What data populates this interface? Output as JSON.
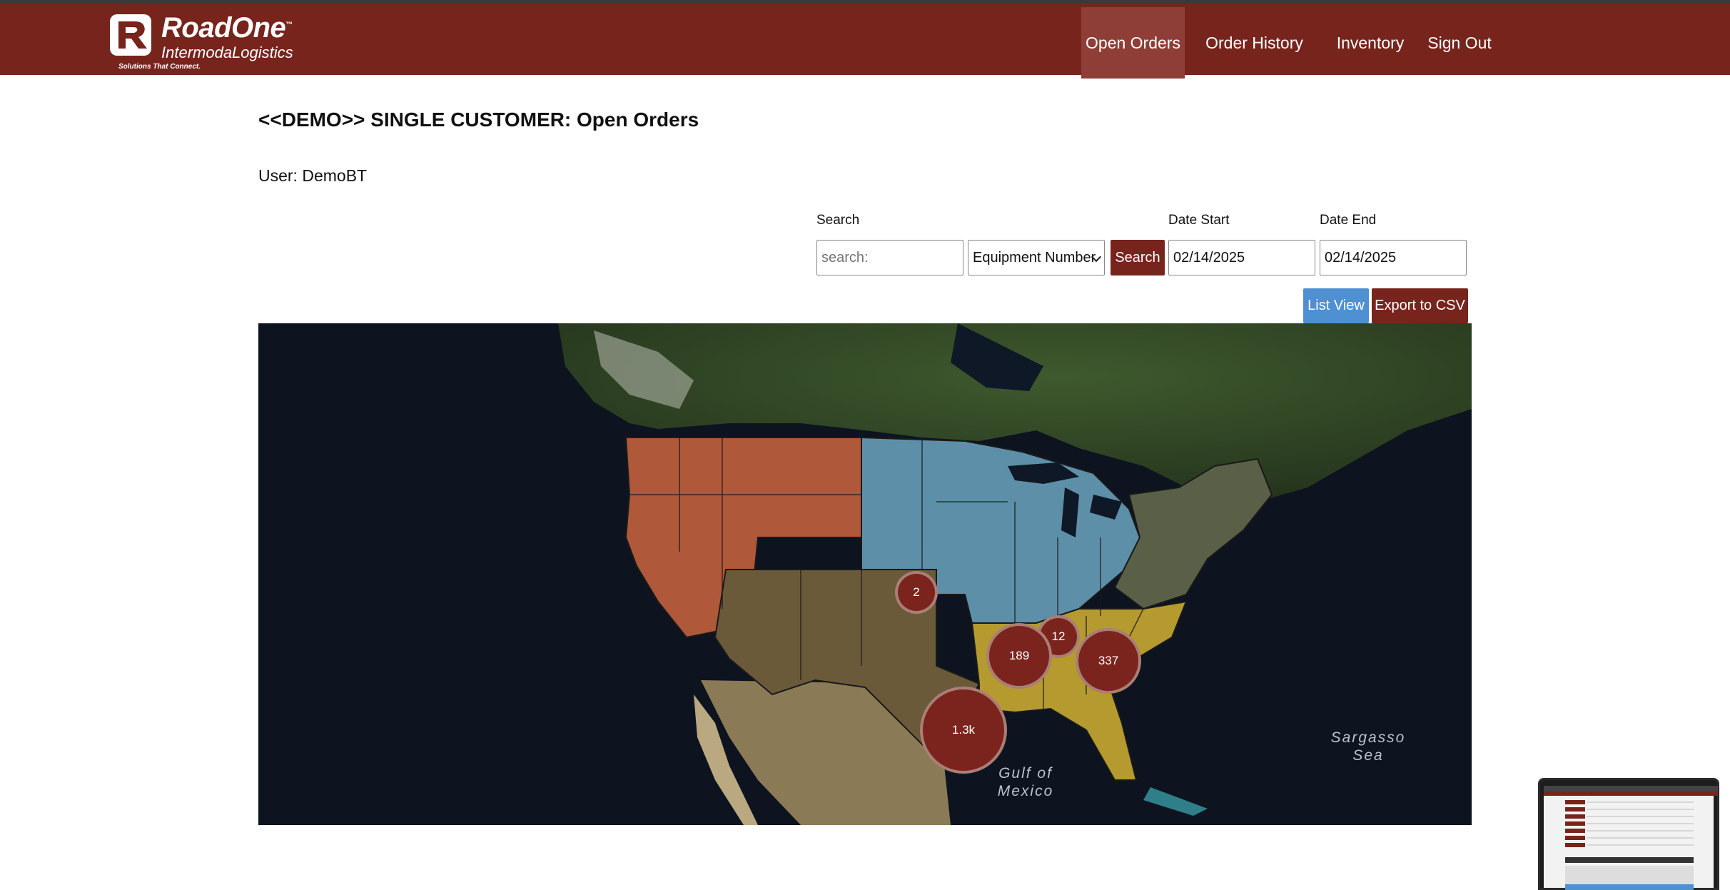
{
  "brand": {
    "name": "RoadOne",
    "tm": "™",
    "subtitle": "IntermodaLogistics",
    "tagline": "Solutions That Connect."
  },
  "nav": {
    "items": [
      {
        "label": "Open Orders",
        "active": true
      },
      {
        "label": "Order History",
        "active": false
      },
      {
        "label": "Inventory",
        "active": false
      },
      {
        "label": "Sign Out",
        "active": false
      }
    ]
  },
  "page": {
    "title": "<<DEMO>> SINGLE CUSTOMER: Open Orders",
    "user_line": "User: DemoBT"
  },
  "filters": {
    "search_label": "Search",
    "search_placeholder": "search:",
    "search_field_selected": "Equipment Number",
    "search_button": "Search",
    "date_start_label": "Date Start",
    "date_start_value": "02/14/2025",
    "date_end_label": "Date End",
    "date_end_value": "02/14/2025"
  },
  "actions": {
    "list_view": "List View",
    "export_csv": "Export to CSV"
  },
  "map": {
    "clusters": [
      {
        "count": "2",
        "region": "kansas"
      },
      {
        "count": "12",
        "region": "tennessee"
      },
      {
        "count": "189",
        "region": "arkansas-mississippi"
      },
      {
        "count": "337",
        "region": "georgia-carolinas"
      },
      {
        "count": "1.3k",
        "region": "texas-gulf"
      }
    ],
    "labels": {
      "gulf": [
        "Gulf of",
        "Mexico"
      ],
      "sargasso": [
        "Sargasso",
        "Sea"
      ]
    },
    "region_colors": {
      "west": "#b0583a",
      "midwest": "#5e8fa8",
      "south": "#b59a2f",
      "southwest": "#6a5a3a",
      "northeast": "#5a6048"
    }
  },
  "colors": {
    "brand": "#77241d",
    "accent_blue": "#4f90d3"
  }
}
